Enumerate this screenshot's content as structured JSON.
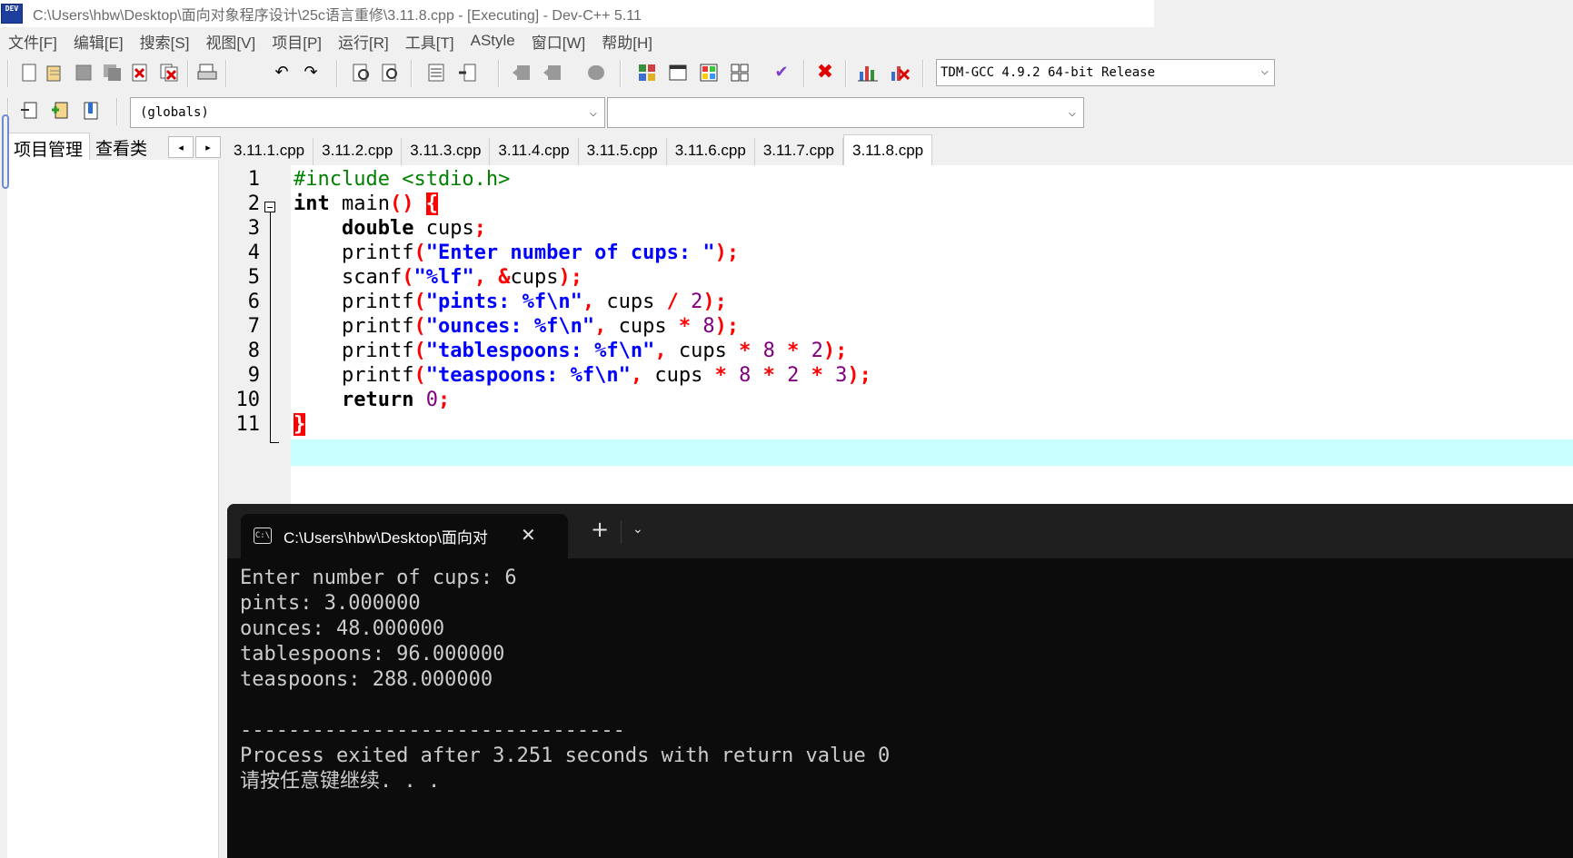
{
  "window": {
    "icon_text": "DEV",
    "title": "C:\\Users\\hbw\\Desktop\\面向对象程序设计\\25c语言重修\\3.11.8.cpp - [Executing] - Dev-C++ 5.11"
  },
  "menu": [
    "文件[F]",
    "编辑[E]",
    "搜索[S]",
    "视图[V]",
    "项目[P]",
    "运行[R]",
    "工具[T]",
    "AStyle",
    "窗口[W]",
    "帮助[H]"
  ],
  "toolbar": {
    "compiler": "TDM-GCC 4.9.2 64-bit Release",
    "scope": "(globals)",
    "symbol": ""
  },
  "left_panel": {
    "tabs": [
      "项目管理",
      "查看类"
    ],
    "arrow_left": "◂",
    "arrow_right": "▸"
  },
  "file_tabs": [
    "3.11.1.cpp",
    "3.11.2.cpp",
    "3.11.3.cpp",
    "3.11.4.cpp",
    "3.11.5.cpp",
    "3.11.6.cpp",
    "3.11.7.cpp",
    "3.11.8.cpp"
  ],
  "active_file_tab": "3.11.8.cpp",
  "editor": {
    "line_numbers": [
      "1",
      "2",
      "3",
      "4",
      "5",
      "6",
      "7",
      "8",
      "9",
      "10",
      "11"
    ],
    "code_lines": [
      "#include <stdio.h>",
      "int main() {",
      "    double cups;",
      "    printf(\"Enter number of cups: \");",
      "    scanf(\"%lf\", &cups);",
      "    printf(\"pints: %f\\n\", cups / 2);",
      "    printf(\"ounces: %f\\n\", cups * 8);",
      "    printf(\"tablespoons: %f\\n\", cups * 8 * 2);",
      "    printf(\"teaspoons: %f\\n\", cups * 8 * 2 * 3);",
      "    return 0;",
      "}"
    ]
  },
  "console": {
    "tab_title": "C:\\Users\\hbw\\Desktop\\面向对",
    "icon_text": "C:\\",
    "close": "✕",
    "new_tab": "+",
    "dropdown": "⌄",
    "output": "Enter number of cups: 6\npints: 3.000000\nounces: 48.000000\ntablespoons: 96.000000\nteaspoons: 288.000000\n\n--------------------------------\nProcess exited after 3.251 seconds with return value 0\n请按任意键继续. . ."
  }
}
